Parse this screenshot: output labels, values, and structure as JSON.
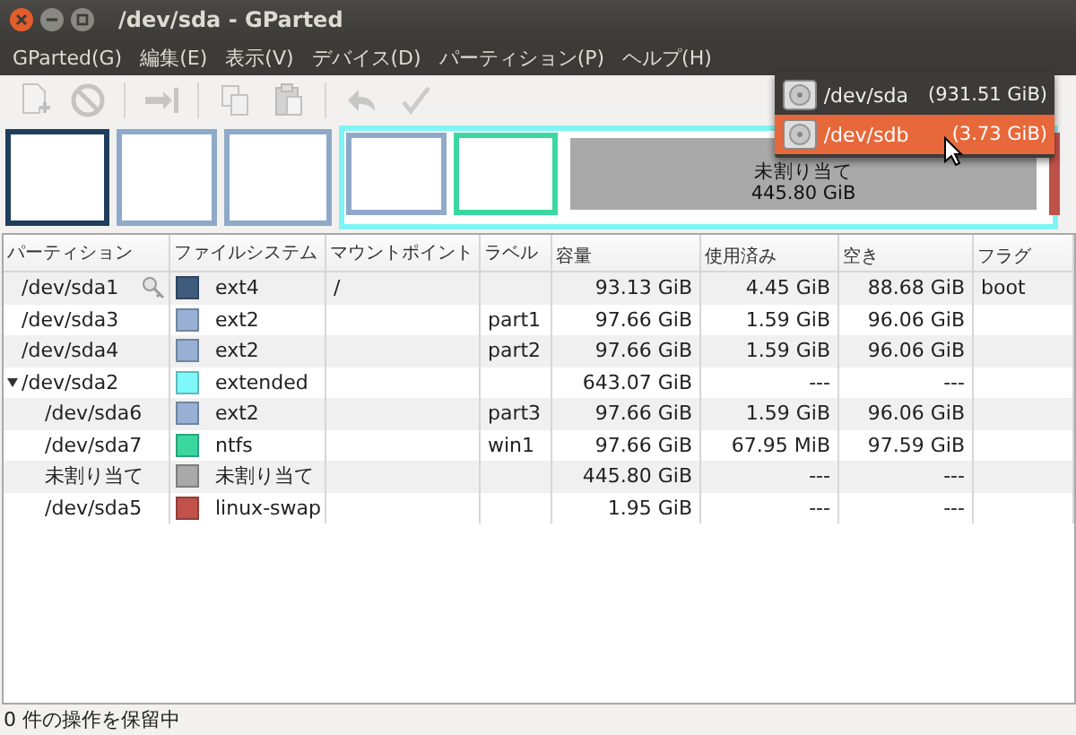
{
  "window": {
    "title": "/dev/sda - GParted"
  },
  "menubar": [
    "GParted(G)",
    "編集(E)",
    "表示(V)",
    "デバイス(D)",
    "パーティション(P)",
    "ヘルプ(H)"
  ],
  "toolbar": [
    {
      "kind": "new",
      "disabled": true
    },
    {
      "kind": "delete",
      "disabled": true
    },
    {
      "kind": "separator"
    },
    {
      "kind": "resize",
      "disabled": true
    },
    {
      "kind": "separator"
    },
    {
      "kind": "copy",
      "disabled": true
    },
    {
      "kind": "paste",
      "disabled": true
    },
    {
      "kind": "separator"
    },
    {
      "kind": "undo",
      "disabled": true
    },
    {
      "kind": "apply",
      "disabled": true
    }
  ],
  "partition_map": {
    "segments": [
      {
        "kind": "primary",
        "color": "#1f3d5c"
      },
      {
        "kind": "primary",
        "color": "#8fa9c9"
      },
      {
        "kind": "primary",
        "color": "#8fa9c9"
      },
      {
        "kind": "extended",
        "color": "#7ef5f5",
        "children": [
          {
            "kind": "primary",
            "color": "#8fa9c9"
          },
          {
            "kind": "primary",
            "color": "#3ad8a0"
          },
          {
            "kind": "unallocated",
            "color": "#a9a9a9",
            "label": "未割り当て",
            "size": "445.80 GiB"
          },
          {
            "kind": "primary",
            "color": "#c0524a"
          }
        ]
      }
    ]
  },
  "table": {
    "columns": [
      "パーティション",
      "ファイルシステム",
      "マウントポイント",
      "ラベル",
      "容量",
      "使用済み",
      "空き",
      "フラグ"
    ],
    "rows": [
      {
        "partition": "/dev/sda1",
        "mounted": true,
        "color": "#3f5b7e",
        "filesystem": "ext4",
        "mountpoint": "/",
        "size": "93.13 GiB",
        "used": "4.45 GiB",
        "free": "88.68 GiB",
        "flags": "boot"
      },
      {
        "partition": "/dev/sda3",
        "mounted": false,
        "color": "#97b0d4",
        "filesystem": "ext2",
        "label": "part1",
        "size": "97.66 GiB",
        "used": "1.59 GiB",
        "free": "96.06 GiB"
      },
      {
        "partition": "/dev/sda4",
        "mounted": false,
        "color": "#97b0d4",
        "filesystem": "ext2",
        "label": "part2",
        "size": "97.66 GiB",
        "used": "1.59 GiB",
        "free": "96.06 GiB"
      },
      {
        "partition": "/dev/sda2",
        "mounted": false,
        "color": "#7ef8f8",
        "filesystem": "extended",
        "size": "643.07 GiB",
        "used": "---",
        "free": "---",
        "expanded": true,
        "children": [
          {
            "partition": "/dev/sda6",
            "mounted": false,
            "color": "#97b0d4",
            "filesystem": "ext2",
            "label": "part3",
            "size": "97.66 GiB",
            "used": "1.59 GiB",
            "free": "96.06 GiB"
          },
          {
            "partition": "/dev/sda7",
            "mounted": false,
            "color": "#3ad8a0",
            "filesystem": "ntfs",
            "label": "win1",
            "size": "97.66 GiB",
            "used": "67.95 MiB",
            "free": "97.59 GiB"
          },
          {
            "partition": "未割り当て",
            "mounted": false,
            "color": "#a9a9a9",
            "filesystem": "未割り当て",
            "size": "445.80 GiB",
            "used": "---",
            "free": "---"
          },
          {
            "partition": "/dev/sda5",
            "mounted": false,
            "color": "#c0524a",
            "filesystem": "linux-swap",
            "size": "1.95 GiB",
            "used": "---",
            "free": "---"
          }
        ]
      }
    ]
  },
  "device_menu": [
    {
      "device": "/dev/sda",
      "size": "(931.51 GiB)",
      "selected": false
    },
    {
      "device": "/dev/sdb",
      "size": "(3.73 GiB)",
      "selected": true
    }
  ],
  "status_bar": "0 件の操作を保留中"
}
